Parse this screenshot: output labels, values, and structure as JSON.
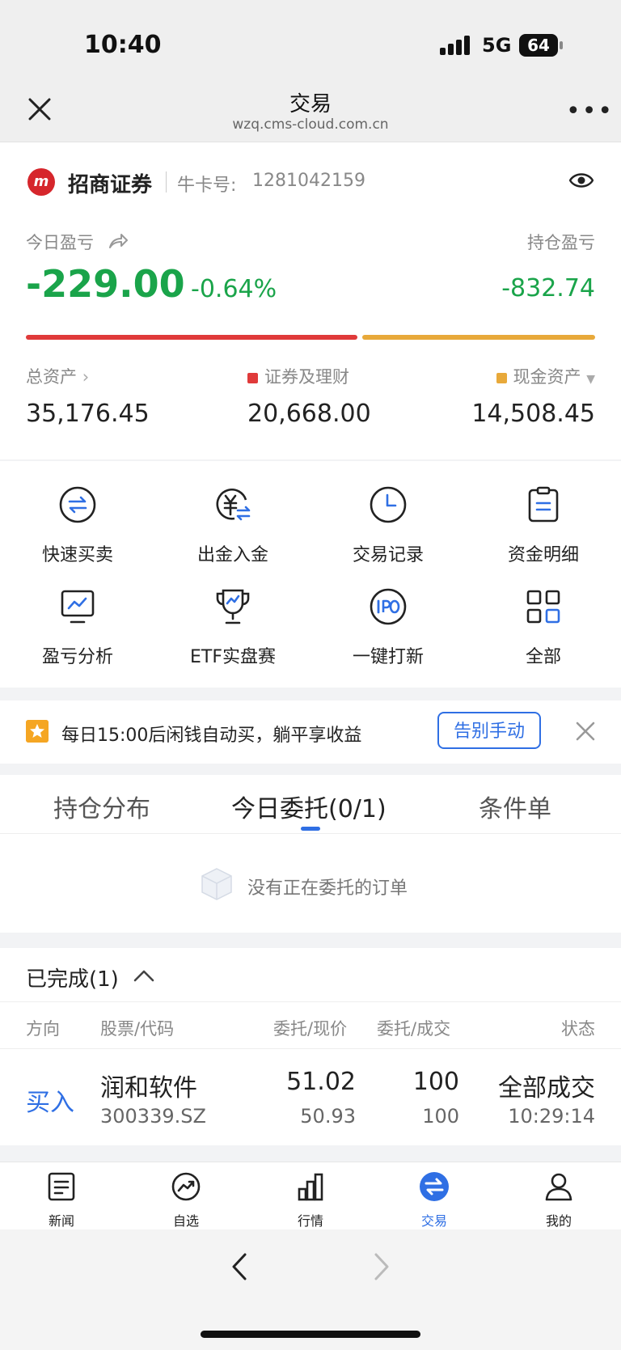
{
  "status": {
    "time": "10:40",
    "network": "5G",
    "battery": "64"
  },
  "nav": {
    "title": "交易",
    "url": "wzq.cms-cloud.com.cn"
  },
  "account": {
    "broker": "招商证券",
    "label": "牛卡号:",
    "number": "1281042159"
  },
  "pnl": {
    "today_label": "今日盈亏",
    "today_value": "-229.00",
    "today_pct": "-0.64%",
    "hold_label": "持仓盈亏",
    "hold_value": "-832.74",
    "securities_share": 0.587
  },
  "assets": {
    "total_label": "总资产",
    "total_value": "35,176.45",
    "sec_label": "证券及理财",
    "sec_value": "20,668.00",
    "cash_label": "现金资产",
    "cash_value": "14,508.45"
  },
  "colors": {
    "accent": "#2f6fe4",
    "gain_loss_green": "#1aa44a",
    "securities": "#e03a3a",
    "cash": "#e8a93a"
  },
  "grid": [
    {
      "label": "快速买卖",
      "icon": "swap-icon"
    },
    {
      "label": "出金入金",
      "icon": "yen-transfer-icon"
    },
    {
      "label": "交易记录",
      "icon": "clock-icon"
    },
    {
      "label": "资金明细",
      "icon": "clipboard-icon"
    },
    {
      "label": "盈亏分析",
      "icon": "monitor-chart-icon"
    },
    {
      "label": "ETF实盘赛",
      "icon": "trophy-icon"
    },
    {
      "label": "一键打新",
      "icon": "ipo-icon"
    },
    {
      "label": "全部",
      "icon": "apps-grid-icon"
    }
  ],
  "banner": {
    "text": "每日15:00后闲钱自动买，躺平享收益",
    "button": "告别手动"
  },
  "tabs": [
    "持仓分布",
    "今日委托(0/1)",
    "条件单"
  ],
  "empty": {
    "text": "没有正在委托的订单"
  },
  "completed": {
    "title": "已完成(1)",
    "headers": [
      "方向",
      "股票/代码",
      "委托/现价",
      "委托/成交",
      "状态"
    ],
    "rows": [
      {
        "direction": "买入",
        "name": "润和软件",
        "code": "300339.SZ",
        "order_price": "51.02",
        "current_price": "50.93",
        "order_qty": "100",
        "filled_qty": "100",
        "status": "全部成交",
        "time": "10:29:14"
      }
    ]
  },
  "tabbar": [
    "新闻",
    "自选",
    "行情",
    "交易",
    "我的"
  ]
}
